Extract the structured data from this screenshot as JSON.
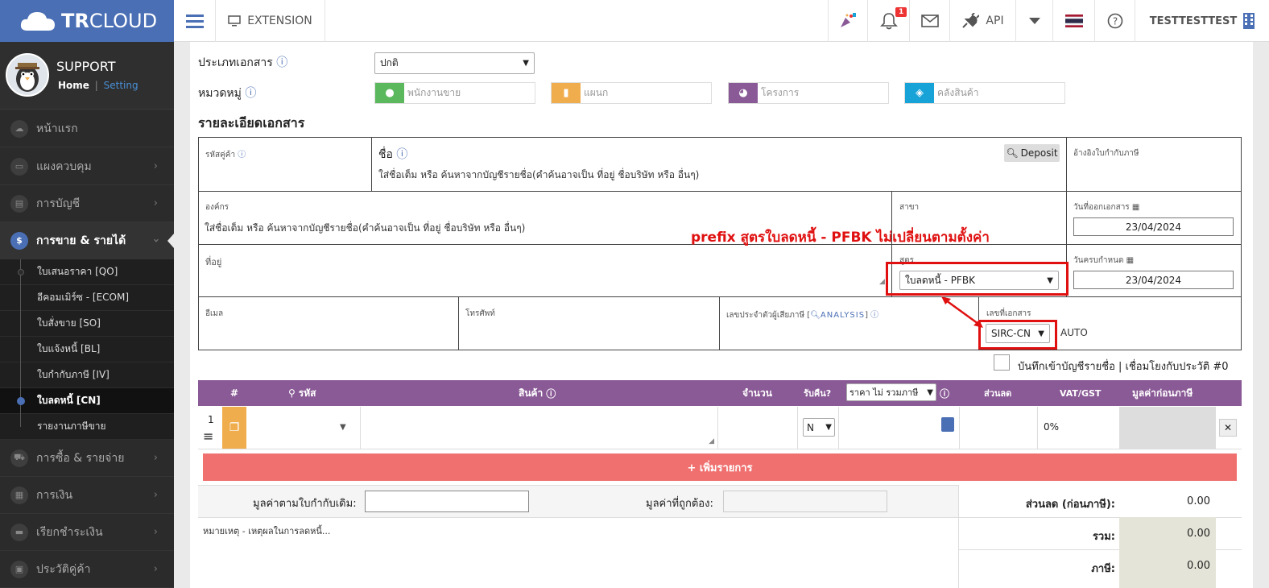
{
  "app": {
    "brand_bold": "TR",
    "brand_rest": "CLOUD"
  },
  "topbar": {
    "extension_label": "EXTENSION",
    "notification_count": "1",
    "api_label": "API",
    "user_label": "TESTTESTTEST"
  },
  "profile": {
    "name": "SUPPORT",
    "home": "Home",
    "sep": "|",
    "setting": "Setting"
  },
  "sidebar": {
    "items": [
      {
        "label": "หน้าแรก"
      },
      {
        "label": "แผงควบคุม"
      },
      {
        "label": "การบัญชี"
      },
      {
        "label": "การขาย & รายได้"
      },
      {
        "label": "การซื้อ & รายจ่าย"
      },
      {
        "label": "การเงิน"
      },
      {
        "label": "เรียกชำระเงิน"
      },
      {
        "label": "ประวัติคู่ค้า"
      }
    ],
    "sub_items": [
      {
        "label": "ใบเสนอราคา [QO]"
      },
      {
        "label": "อีคอมเมิร์ซ - [ECOM]"
      },
      {
        "label": "ใบสั่งขาย [SO]"
      },
      {
        "label": "ใบแจ้งหนี้ [BL]"
      },
      {
        "label": "ใบกำกับภาษี [IV]"
      },
      {
        "label": "ใบลดหนี้ [CN]"
      },
      {
        "label": "รายงานภาษีขาย"
      }
    ]
  },
  "form": {
    "doc_type_label": "ประเภทเอกสาร",
    "doc_type_value": "ปกติ",
    "category_label": "หมวดหมู่",
    "tags": {
      "salesperson": "พนักงานขาย",
      "department": "แผนก",
      "project": "โครงการ",
      "warehouse": "คลังสินค้า"
    },
    "section_title": "รายละเอียดเอกสาร",
    "customer_code_label": "รหัสคู่ค้า",
    "name_label": "ชื่อ",
    "name_placeholder": "ใส่ชื่อเต็ม หรือ ค้นหาจากบัญชีรายชื่อ(คำค้นอาจเป็น ที่อยู่ ชื่อบริษัท หรือ อื่นๆ)",
    "deposit_label": "Deposit",
    "ref_tax_invoice_label": "อ้างอิงใบกำกับภาษี",
    "org_label": "องค์กร",
    "org_placeholder": "ใส่ชื่อเต็ม หรือ ค้นหาจากบัญชีรายชื่อ(คำค้นอาจเป็น ที่อยู่ ชื่อบริษัท หรือ อื่นๆ)",
    "branch_label": "สาขา",
    "issue_date_label": "วันที่ออกเอกสาร",
    "issue_date": "23/04/2024",
    "address_label": "ที่อยู่",
    "formula_label": "สูตร",
    "formula_value": "ใบลดหนี้ - PFBK",
    "due_date_label": "วันครบกำหนด",
    "due_date": "23/04/2024",
    "email_label": "อีเมล",
    "phone_label": "โทรศัพท์",
    "taxid_label": "เลขประจำตัวผู้เสียภาษี [",
    "analysis_label": "ANALYSIS",
    "taxid_close": "]",
    "docno_label": "เลขที่เอกสาร",
    "docno_prefix": "SIRC-CN",
    "auto_label": "AUTO",
    "save_contact_label": "บันทึกเข้าบัญชีรายชื่อ | เชื่อมโยงกับประวัติ #0",
    "annotation": "prefix สูตรใบลดหนี้ - PFBK ไม่เปลี่ยนตามตั้งค่า"
  },
  "table": {
    "headers": {
      "num": "#",
      "code": "รหัส",
      "product": "สินค้า",
      "qty": "จำนวน",
      "return": "รับคืน?",
      "price_type": "ราคา ไม่ รวมภาษี",
      "discount": "ส่วนลด",
      "vat": "VAT/GST",
      "pretax": "มูลค่าก่อนภาษี"
    },
    "row": {
      "index": "1",
      "return_value": "N",
      "vat_value": "0%"
    },
    "add_row_label": "+ เพิ่มรายการ"
  },
  "summary": {
    "orig_value_label": "มูลค่าตามใบกำกับเดิม:",
    "correct_value_label": "มูลค่าที่ถูกต้อง:",
    "note_placeholder": "หมายเหตุ - เหตุผลในการลดหนี้...",
    "discount_label": "ส่วนลด (ก่อนภาษี):",
    "discount_value": "0.00",
    "total_label": "รวม:",
    "total_value": "0.00",
    "tax_label": "ภาษี:",
    "tax_value": "0.00"
  },
  "colors": {
    "brand": "#4a6fb5",
    "table_header": "#8a5a96",
    "add_row": "#f07070",
    "annotation": "#e01010",
    "tag_green": "#5cb85c",
    "tag_yellow": "#f0ad4e",
    "tag_purple": "#8a5a96",
    "tag_cyan": "#17a2d8"
  }
}
